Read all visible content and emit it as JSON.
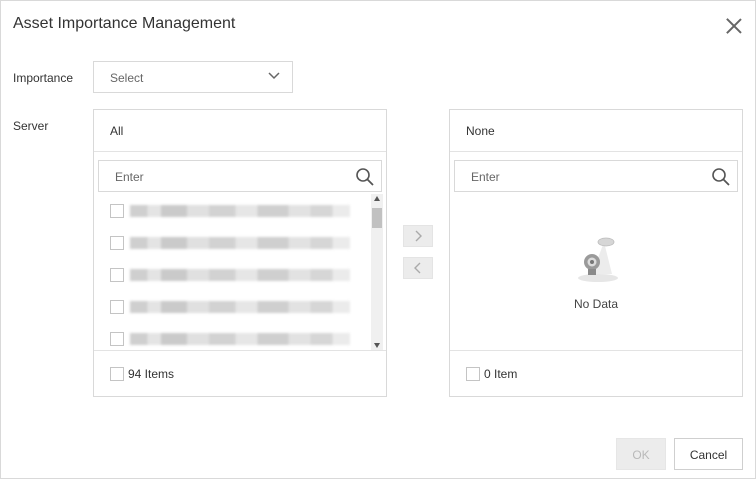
{
  "dialog": {
    "title": "Asset Importance Management"
  },
  "form": {
    "importance_label": "Importance",
    "importance_placeholder": "Select",
    "server_label": "Server"
  },
  "source_panel": {
    "header": "All",
    "search_placeholder": "Enter",
    "count_text": "94 Items",
    "rows": [
      "",
      "",
      "",
      "",
      ""
    ]
  },
  "target_panel": {
    "header": "None",
    "search_placeholder": "Enter",
    "empty_text": "No Data",
    "count_text": "0 Item"
  },
  "footer": {
    "ok_label": "OK",
    "cancel_label": "Cancel"
  },
  "icons": {
    "close": "close-icon",
    "dropdown": "chevron-down-icon",
    "search": "search-icon",
    "move_right": "chevron-right-icon",
    "move_left": "chevron-left-icon",
    "empty": "empty-state-icon"
  },
  "colors": {
    "border": "#d9d9d9",
    "disabled_bg": "#ececec",
    "disabled_text": "#b9b9b9"
  }
}
